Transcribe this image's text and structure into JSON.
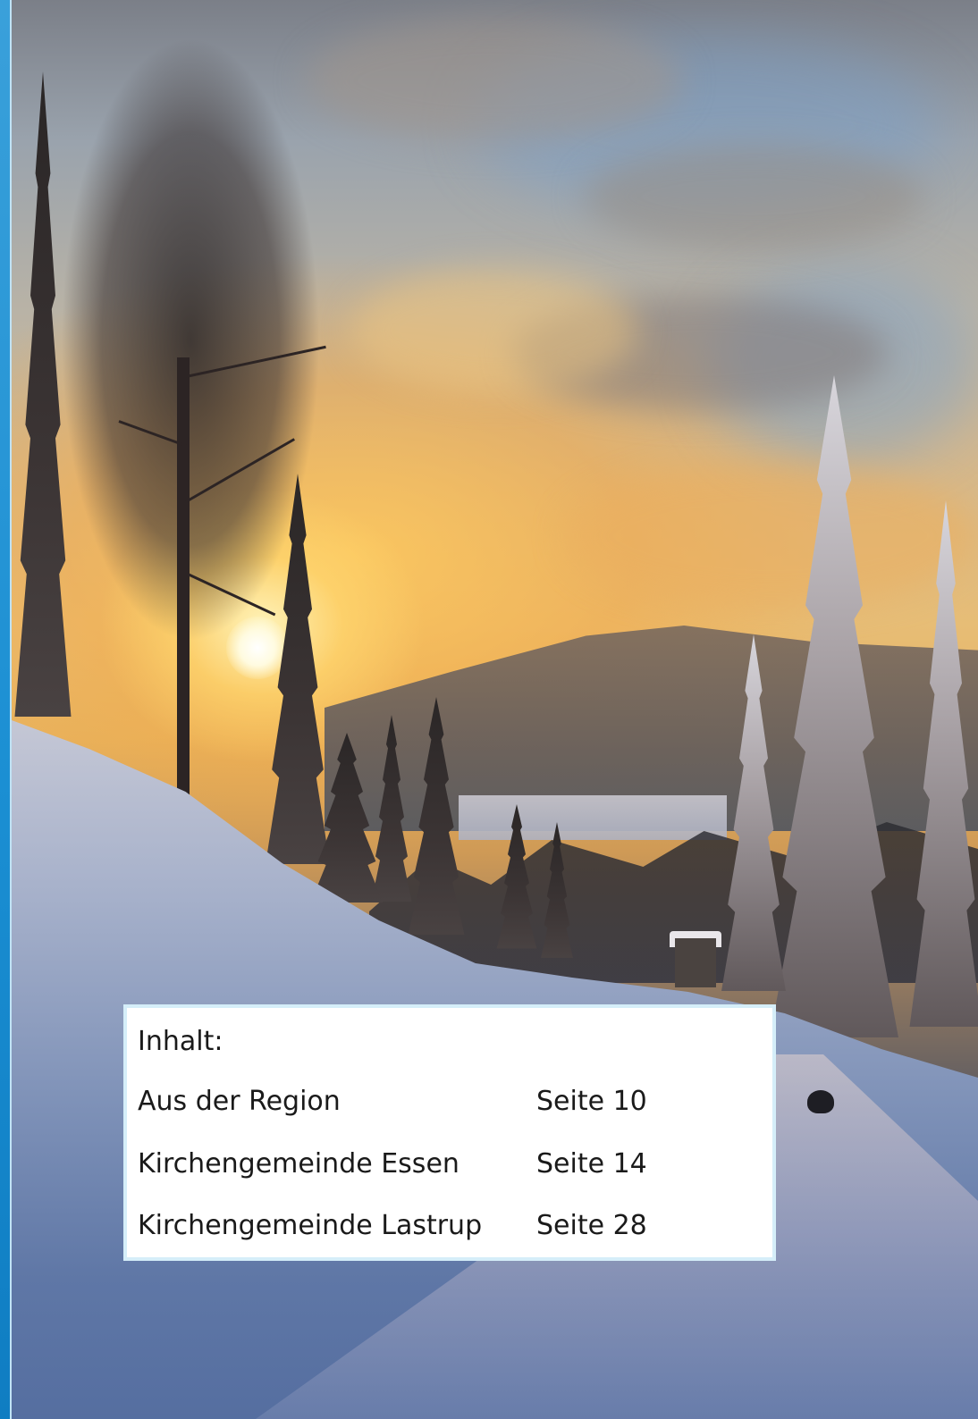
{
  "cover_image": {
    "description_name": "winter-sunset-landscape"
  },
  "toc": {
    "heading": "Inhalt:",
    "entries": [
      {
        "label": "Aus der Region",
        "page": "Seite 10"
      },
      {
        "label": "Kirchengemeinde Essen",
        "page": "Seite 14"
      },
      {
        "label": "Kirchengemeinde Lastrup",
        "page": "Seite 28"
      }
    ]
  },
  "colors": {
    "accent_bar": "#1b8fd3",
    "toc_border": "#d5eef9",
    "toc_background": "#ffffff"
  }
}
